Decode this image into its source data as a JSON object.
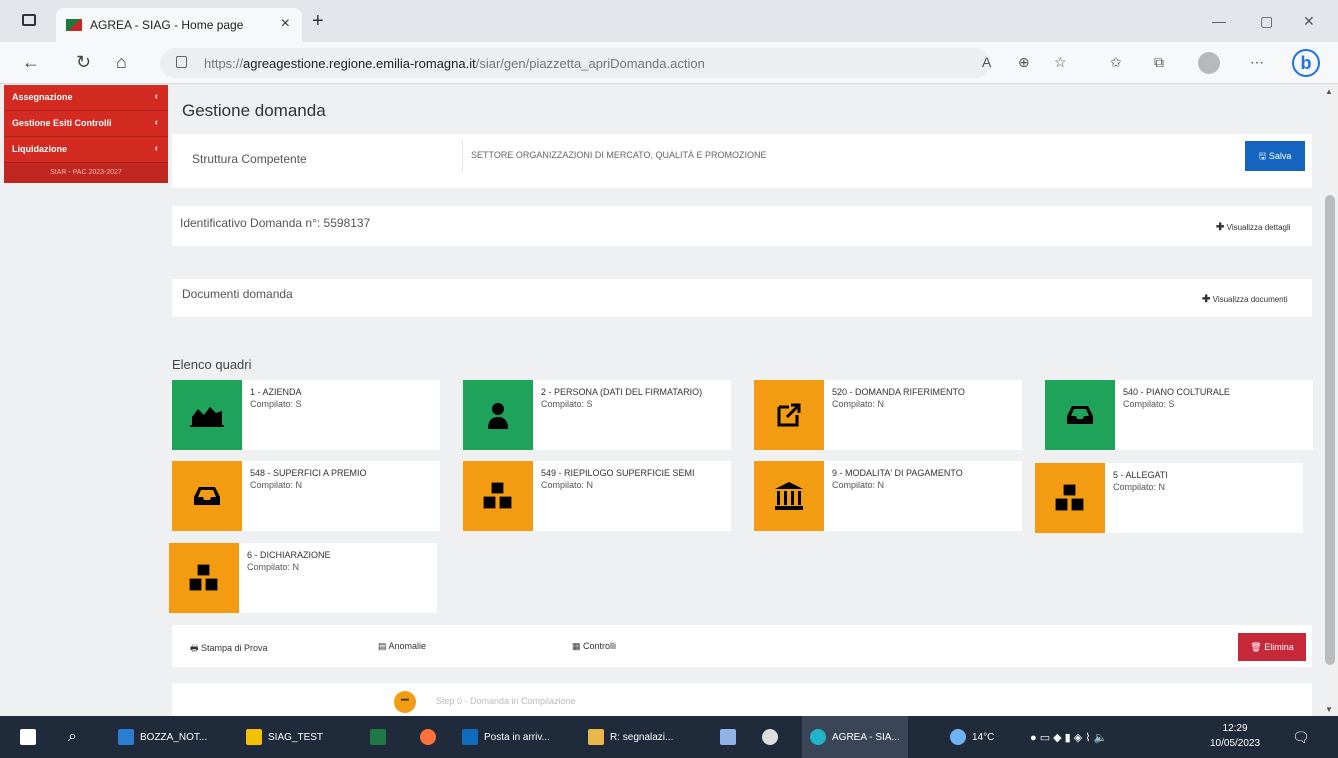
{
  "browser": {
    "tab_title": "AGREA - SIAG - Home page",
    "url_prefix": "https://",
    "url_host": "agreagestione.regione.emilia-romagna.it",
    "url_path": "/siar/gen/piazzetta_apriDomanda.action"
  },
  "sidebar": {
    "items": [
      {
        "label": "Assegnazione"
      },
      {
        "label": "Gestione Esiti Controlli"
      },
      {
        "label": "Liquidazione"
      }
    ],
    "sub_label": "SIAR - PAC 2023-2027"
  },
  "page": {
    "title": "Gestione domanda",
    "struttura_label": "Struttura Competente",
    "struttura_value": "SETTORE ORGANIZZAZIONI DI MERCATO, QUALITÀ E PROMOZIONE",
    "save_label": "Salva",
    "identificativo_label": "Identificativo Domanda n°: 5598137",
    "visualizza_dettagli": "Visualizza dettagli",
    "documenti_label": "Documenti domanda",
    "visualizza_documenti": "Visualizza documenti",
    "elenco_quadri": "Elenco quadri"
  },
  "quadri": [
    {
      "title": "1 - AZIENDA",
      "status": "Compilato: S",
      "color": "#1fa35a",
      "icon": "area-chart-icon"
    },
    {
      "title": "2 - PERSONA (DATI DEL FIRMATARIO)",
      "status": "Compilato: S",
      "color": "#1fa35a",
      "icon": "user-icon"
    },
    {
      "title": "520 - DOMANDA RIFERIMENTO",
      "status": "Compilato: N",
      "color": "#f39c12",
      "icon": "external-link-icon"
    },
    {
      "title": "540 - PIANO COLTURALE",
      "status": "Compilato: S",
      "color": "#1fa35a",
      "icon": "inbox-icon"
    },
    {
      "title": "548 - SUPERFICI A PREMIO",
      "status": "Compilato: N",
      "color": "#f39c12",
      "icon": "inbox-icon"
    },
    {
      "title": "549 - RIEPILOGO SUPERFICIE SEMI",
      "status": "Compilato: N",
      "color": "#f39c12",
      "icon": "cubes-icon"
    },
    {
      "title": "9 - MODALITA' DI PAGAMENTO",
      "status": "Compilato: N",
      "color": "#f39c12",
      "icon": "bank-icon"
    },
    {
      "title": "5 - ALLEGATI",
      "status": "Compilato: N",
      "color": "#f39c12",
      "icon": "cubes-icon"
    },
    {
      "title": "6 - DICHIARAZIONE",
      "status": "Compilato: N",
      "color": "#f39c12",
      "icon": "cubes-icon"
    }
  ],
  "actions": {
    "stampa": "Stampa di Prova",
    "anomalie": "Anomalie",
    "controlli": "Controlli",
    "elimina": "Elimina"
  },
  "step": {
    "label": "Step 0 - Domanda in Compilazione"
  },
  "taskbar": {
    "items": [
      "BOZZA_NOT...",
      "SIAG_TEST",
      "Posta in arriv...",
      "R: segnalazi...",
      "AGREA - SIA..."
    ],
    "temperature": "14°C",
    "time": "12:29",
    "date": "10/05/2023"
  }
}
